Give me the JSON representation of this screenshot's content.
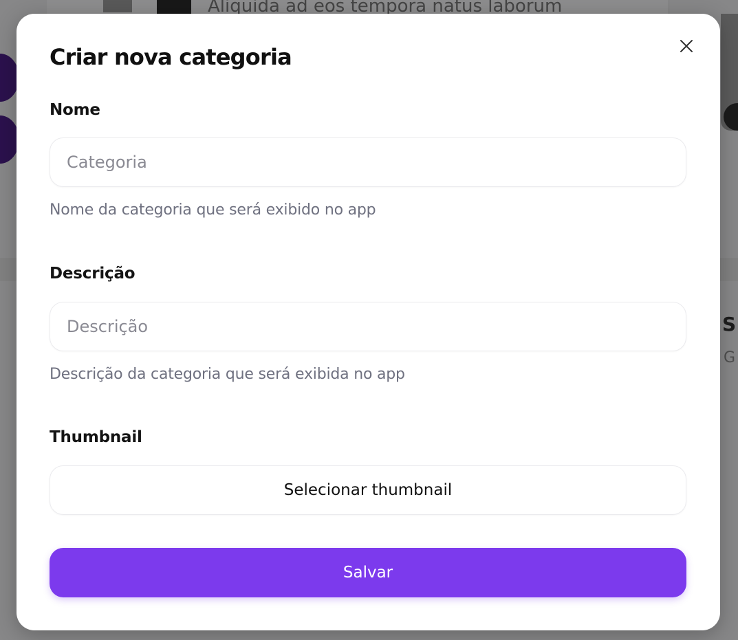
{
  "background": {
    "card_text": "Aliquida ad eos tempora natus laborum",
    "right_letter": "S",
    "right_letter_2": "G"
  },
  "modal": {
    "title": "Criar nova categoria",
    "close_icon": "close-icon",
    "name_field": {
      "label": "Nome",
      "placeholder": "Categoria",
      "value": "",
      "helper": "Nome da categoria que será exibido no app"
    },
    "description_field": {
      "label": "Descrição",
      "placeholder": "Descrição",
      "value": "",
      "helper": "Descrição da categoria que será exibida no app"
    },
    "thumbnail_field": {
      "label": "Thumbnail",
      "button_label": "Selecionar thumbnail"
    },
    "save_label": "Salvar"
  },
  "colors": {
    "accent": "#7c3aed",
    "overlay": "rgba(0,0,0,0.42)",
    "helper_text": "#6f7180",
    "placeholder": "#8a8a93"
  }
}
